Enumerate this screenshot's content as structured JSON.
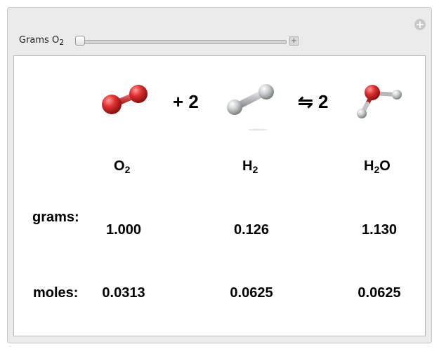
{
  "control": {
    "label_main": "Grams O",
    "label_sub": "2",
    "slider_value": 0,
    "reset_icon": "plus-circle-icon",
    "expand_icon": "plus-box-icon",
    "expand_glyph": "+"
  },
  "reaction": {
    "coef_h2": "+ 2",
    "arrow_coef": "⇋ 2"
  },
  "columns": [
    {
      "formula_main": "O",
      "formula_sub": "2",
      "formula_tail": "",
      "grams": "1.000",
      "moles": "0.0313"
    },
    {
      "formula_main": "H",
      "formula_sub": "2",
      "formula_tail": "",
      "grams": "0.126",
      "moles": "0.0625"
    },
    {
      "formula_main": "H",
      "formula_sub": "2",
      "formula_tail": "O",
      "grams": "1.130",
      "moles": "0.0625"
    }
  ],
  "rows": {
    "grams_label": "grams:",
    "moles_label": "moles:"
  },
  "colors": {
    "oxygen": "#e03030",
    "hydrogen": "#d8dcdc"
  }
}
